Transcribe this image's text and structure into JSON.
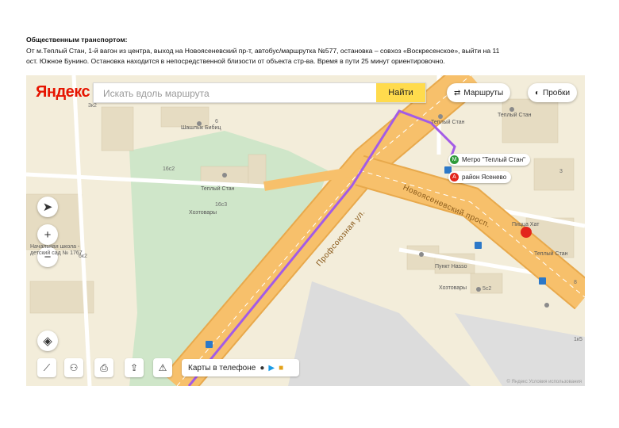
{
  "heading": {
    "title": "Общественным транспортом:",
    "line1": "От м.Теплый Стан, 1-й вагон из центра, выход на Новоясеневский пр-т, автобус/маршрутка №577, остановка – совхоз «Воскресенское», выйти на 11",
    "line2": "ост. Южное Бунино. Остановка находится в непосредственной близости от объекта стр-ва. Время в пути 25 минут ориентировочно."
  },
  "map": {
    "logo": "Яндекс",
    "search_placeholder": "Искать вдоль маршрута",
    "find_button": "Найти",
    "routes_button": "Маршруты",
    "traffic_button": "Пробки",
    "zoom_in": "+",
    "zoom_out": "−",
    "promo_text": "Карты в телефоне",
    "metro_label": "Метро \"Теплый Стан\"",
    "destination_label": "район Ясенево",
    "roads": {
      "profsoyuznaya": "Профсоюзная ул.",
      "novoyasenevsky": "Новоясеневский просп."
    },
    "labels": {
      "l1": "Теплый Стан",
      "l2": "Теплый Стан",
      "l3": "Теплый Стан",
      "l4": "Теплый Стан",
      "l5": "Хозтовары",
      "l6": "Хозтовары",
      "l7": "Шашлык Бибиц",
      "l8": "Начальная школа - детский сад № 1767",
      "l9": "Пункт Hasso",
      "l10": "Пицца Хат",
      "l11": "16с3",
      "l12": "16с2",
      "l13": "3к2",
      "l14": "5с2",
      "l15": "6к2",
      "l16": "3",
      "l17": "8",
      "l18": "1к5",
      "l19": "6"
    },
    "copyright": "© Яндекс Условия использования"
  },
  "colors": {
    "road": "#f7c06b",
    "route": "#a35be6",
    "park": "#c8e4c8",
    "accent": "#ffdb4d"
  }
}
